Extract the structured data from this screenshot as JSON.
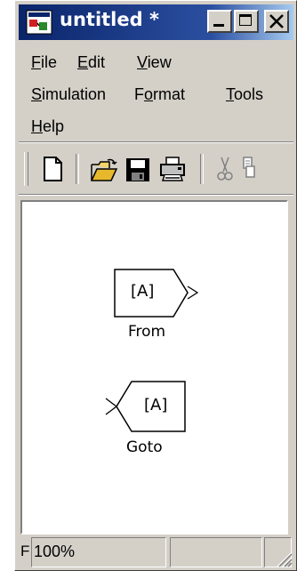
{
  "window": {
    "title": "untitled *",
    "controls": [
      "minimize",
      "maximize",
      "close"
    ]
  },
  "menu": {
    "rows": [
      [
        {
          "key": "F",
          "rest": "ile"
        },
        {
          "key": "E",
          "rest": "dit"
        },
        {
          "key": "V",
          "rest": "iew"
        }
      ],
      [
        {
          "key": "S",
          "rest": "imulation"
        },
        {
          "pre": "F",
          "key": "o",
          "rest": "rmat"
        },
        {
          "key": "T",
          "rest": "ools"
        }
      ],
      [
        {
          "key": "H",
          "rest": "elp"
        }
      ]
    ]
  },
  "toolbar": {
    "icons": [
      "new-model-icon",
      "open-icon",
      "save-icon",
      "print-icon",
      "cut-icon",
      "copy-icon"
    ]
  },
  "blocks": {
    "from": {
      "text": "[A]",
      "label": "From"
    },
    "goto": {
      "text": "[A]",
      "label": "Goto"
    }
  },
  "status": {
    "prefix": "F",
    "zoom": "100%"
  }
}
